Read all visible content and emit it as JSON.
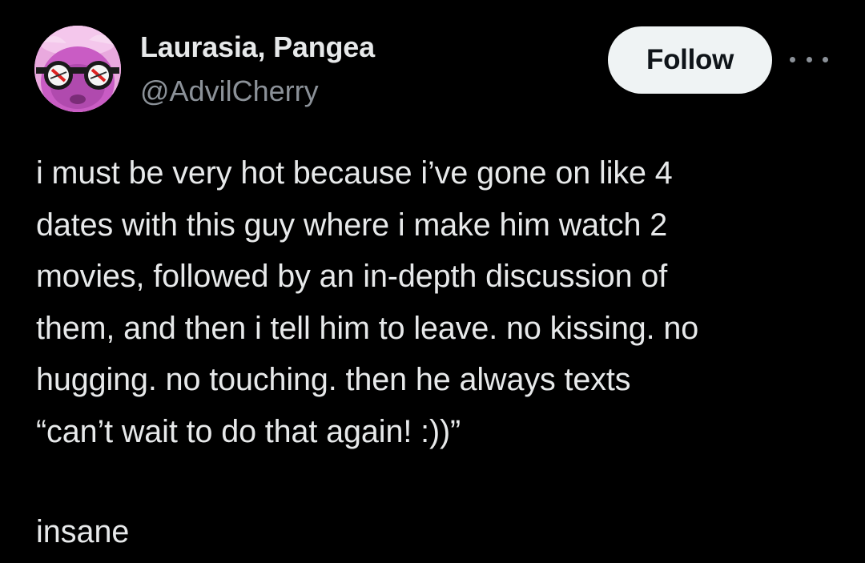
{
  "author": {
    "display_name": "Laurasia, Pangea",
    "handle": "@AdvilCherry",
    "avatar_icon": "pink-character-avatar-with-glasses"
  },
  "actions": {
    "follow_label": "Follow",
    "more_icon": "more-horizontal-icon"
  },
  "tweet": {
    "lines": [
      "i must be very hot because i’ve gone on like 4",
      "dates with this guy where i make him watch 2",
      "movies, followed by an in-depth discussion of",
      "them, and then i tell him to leave. no kissing. no",
      "hugging. no touching. then he always texts",
      "“can’t wait to do that again! :))”"
    ],
    "closing": "insane"
  },
  "colors": {
    "background": "#000000",
    "primary_text": "#e7e9ea",
    "secondary_text": "#8b9198",
    "follow_bg": "#eff3f4",
    "follow_text": "#0f1419"
  }
}
